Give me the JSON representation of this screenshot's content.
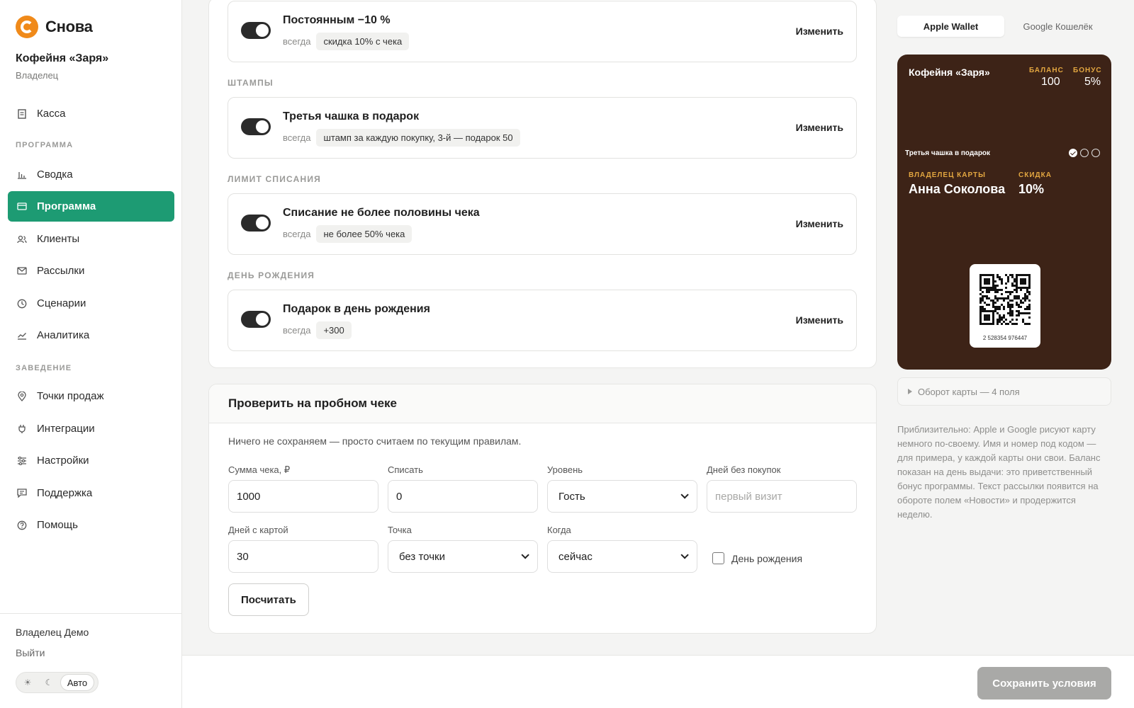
{
  "brand": {
    "name": "Снова",
    "accent": "#1d9b73",
    "logo_color": "#f08a1a"
  },
  "org": {
    "name": "Кофейня «Заря»",
    "role": "Владелец"
  },
  "nav": {
    "top_item": {
      "label": "Касса",
      "icon": "receipt-icon"
    },
    "section_program": "ПРОГРАММА",
    "program_items": [
      {
        "label": "Сводка",
        "icon": "bar-chart-icon"
      },
      {
        "label": "Программа",
        "icon": "card-icon",
        "active": true
      },
      {
        "label": "Клиенты",
        "icon": "users-icon"
      },
      {
        "label": "Рассылки",
        "icon": "mail-icon"
      },
      {
        "label": "Сценарии",
        "icon": "clock-icon"
      },
      {
        "label": "Аналитика",
        "icon": "trend-icon"
      }
    ],
    "section_venue": "ЗАВЕДЕНИЕ",
    "venue_items": [
      {
        "label": "Точки продаж",
        "icon": "pin-icon"
      },
      {
        "label": "Интеграции",
        "icon": "plug-icon"
      },
      {
        "label": "Настройки",
        "icon": "sliders-icon"
      },
      {
        "label": "Поддержка",
        "icon": "chat-icon"
      },
      {
        "label": "Помощь",
        "icon": "help-icon"
      }
    ]
  },
  "user": {
    "name": "Владелец Демо",
    "logout": "Выйти"
  },
  "theme": {
    "light": "☀",
    "dark": "☾",
    "auto": "Авто"
  },
  "rules": [
    {
      "title": "Постоянным −10 %",
      "when": "всегда",
      "chip": "скидка 10% с чека",
      "edit": "Изменить",
      "enabled": true
    },
    {
      "title": "Третья чашка в подарок",
      "when": "всегда",
      "chip": "штамп за каждую покупку, 3-й — подарок 50",
      "edit": "Изменить",
      "enabled": true
    },
    {
      "title": "Списание не более половины чека",
      "when": "всегда",
      "chip": "не более 50% чека",
      "edit": "Изменить",
      "enabled": true
    },
    {
      "title": "Подарок в день рождения",
      "when": "всегда",
      "chip": "+300",
      "edit": "Изменить",
      "enabled": true
    }
  ],
  "sections": {
    "stamps": "ШТАМПЫ",
    "limit": "ЛИМИТ СПИСАНИЯ",
    "birthday": "ДЕНЬ РОЖДЕНИЯ"
  },
  "test": {
    "title": "Проверить на пробном чеке",
    "note": "Ничего не сохраняем — просто считаем по текущим правилам.",
    "sum": {
      "label": "Сумма чека, ₽",
      "value": "1000"
    },
    "writeoff": {
      "label": "Списать",
      "value": "0"
    },
    "level": {
      "label": "Уровень",
      "value": "Гость"
    },
    "days_no_buy": {
      "label": "Дней без покупок",
      "placeholder": "первый визит"
    },
    "days_card": {
      "label": "Дней с картой",
      "value": "30"
    },
    "point": {
      "label": "Точка",
      "value": "без точки"
    },
    "when": {
      "label": "Когда",
      "value": "сейчас"
    },
    "birthday": {
      "label": "День рождения",
      "checked": false
    },
    "calc": "Посчитать"
  },
  "wallet": {
    "tabs": [
      "Apple Wallet",
      "Google Кошелёк"
    ],
    "selected_tab": "Apple Wallet",
    "pass": {
      "org": "Кофейня «Заря»",
      "balance_label": "БАЛАНС",
      "balance": "100",
      "bonus_label": "БОНУС",
      "bonus": "5%",
      "strip": "Третья чашка в подарок",
      "stamps_filled": 1,
      "stamps_total": 3,
      "holder_label": "ВЛАДЕЛЕЦ КАРТЫ",
      "holder": "Анна Соколова",
      "discount_label": "СКИДКА",
      "discount": "10%",
      "card_number": "2 528354 976447",
      "bg_color": "#3d2317",
      "label_color": "#e2a640"
    },
    "back": "Оборот карты — 4 поля",
    "hint": "Приблизительно: Apple и Google рисуют карту немного по-своему. Имя и номер под кодом — для примера, у каждой карты они свои. Баланс показан на день выдачи: это приветственный бонус программы. Текст рассылки появится на обороте полем «Новости» и продержится неделю."
  },
  "save": "Сохранить условия"
}
